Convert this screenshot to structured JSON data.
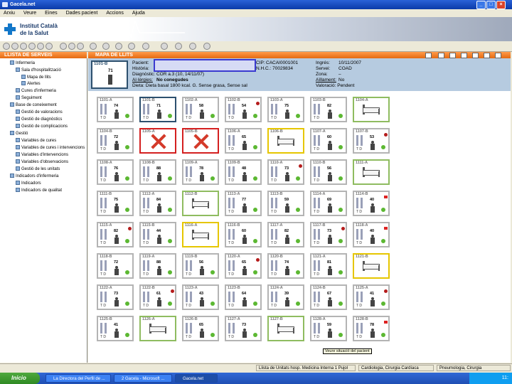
{
  "window": {
    "title": "Gacela.net",
    "min": "_",
    "max": "□",
    "close": "×"
  },
  "menu": [
    "Arxiu",
    "Veure",
    "Eines",
    "Dades pacient",
    "Accions",
    "Ajuda"
  ],
  "logo": {
    "line1": "Institut Català",
    "line2": "de la Salut"
  },
  "left_panel": {
    "title": "LLISTA DE SERVEIS",
    "items": [
      {
        "label": "Infermeria"
      },
      {
        "label": "Sala d'hospitalització"
      },
      {
        "label": "Mapa de llits"
      },
      {
        "label": "Alertes"
      },
      {
        "label": "Cures d'infermeria"
      },
      {
        "label": "Seguiment"
      },
      {
        "label": "Base de coneixement"
      },
      {
        "label": "Gestió de valoracions"
      },
      {
        "label": "Gestió de diagnòstics"
      },
      {
        "label": "Gestió de complicacions"
      },
      {
        "label": "Gestió"
      },
      {
        "label": "Variables de cures"
      },
      {
        "label": "Variables de cures i intervencions"
      },
      {
        "label": "Variables d'intervencions"
      },
      {
        "label": "Variables d'observacions"
      },
      {
        "label": "Gestió de les unitats"
      },
      {
        "label": "Indicadors d'infermeria"
      },
      {
        "label": "Indicadors"
      },
      {
        "label": "Indicadors de qualitat"
      }
    ]
  },
  "main": {
    "title": "MAPA DE LLITS",
    "selected_bed": {
      "number": "1101-B",
      "age": "71"
    },
    "info": {
      "pacient_label": "Pacient:",
      "historia_label": "Història:",
      "diagnostic": "Diagnòstic: COR a.3 (10, 14/11/07)",
      "alergies_label": "Al·lèrgies:",
      "alergies_value": "No conegudes",
      "dieta": "Dieta:   Dieta basal 1800 kcal. G. Sense grasa, Sense sal",
      "cip_label": "CIP:",
      "cip_value": "CACAI0001001",
      "nhc": "N.H.C.: 70029834",
      "ingres_label": "Ingrés:",
      "ingres_value": "10/11/2007",
      "servei_label": "Servei:",
      "servei_value": "COAD",
      "zona_label": "Zona:",
      "zona_value": "–",
      "aillament_label": "Aïllament:",
      "aillament_value": "No",
      "valoracio": "Valoració:   Pendent"
    },
    "tooltip": "Veure situació del pacient",
    "beds": [
      {
        "num": "1101-A",
        "age": "74",
        "state": "occupied"
      },
      {
        "num": "1101-B",
        "age": "71",
        "state": "sel"
      },
      {
        "num": "1102-A",
        "age": "58",
        "state": "occupied"
      },
      {
        "num": "1102-B",
        "age": "54",
        "state": "occupied"
      },
      {
        "num": "1103-A",
        "age": "75",
        "state": "occupied"
      },
      {
        "num": "1103-B",
        "age": "82",
        "state": "occupied"
      },
      {
        "num": "1104-A",
        "age": "",
        "state": "free"
      },
      {
        "num": "1104-B",
        "age": "72",
        "state": "occupied"
      },
      {
        "num": "1105-A",
        "age": "",
        "state": "blocked"
      },
      {
        "num": "1105-B",
        "age": "",
        "state": "blocked"
      },
      {
        "num": "1106-A",
        "age": "65",
        "state": "occupied"
      },
      {
        "num": "1106-B",
        "age": "",
        "state": "yellow"
      },
      {
        "num": "1107-A",
        "age": "60",
        "state": "occupied"
      },
      {
        "num": "1107-B",
        "age": "53",
        "state": "occupied"
      },
      {
        "num": "1108-A",
        "age": "76",
        "state": "occupied"
      },
      {
        "num": "1108-B",
        "age": "88",
        "state": "occupied"
      },
      {
        "num": "1109-A",
        "age": "78",
        "state": "occupied"
      },
      {
        "num": "1109-B",
        "age": "48",
        "state": "occupied"
      },
      {
        "num": "1110-A",
        "age": "73",
        "state": "occupied"
      },
      {
        "num": "1110-B",
        "age": "56",
        "state": "occupied"
      },
      {
        "num": "1111-A",
        "age": "",
        "state": "free"
      },
      {
        "num": "1111-B",
        "age": "75",
        "state": "occupied"
      },
      {
        "num": "1112-A",
        "age": "84",
        "state": "occupied"
      },
      {
        "num": "1112-B",
        "age": "",
        "state": "free"
      },
      {
        "num": "1113-A",
        "age": "77",
        "state": "occupied"
      },
      {
        "num": "1113-B",
        "age": "59",
        "state": "occupied"
      },
      {
        "num": "1114-A",
        "age": "69",
        "state": "occupied"
      },
      {
        "num": "1114-B",
        "age": "40",
        "state": "occupied"
      },
      {
        "num": "1115-A",
        "age": "82",
        "state": "occupied"
      },
      {
        "num": "1115-B",
        "age": "44",
        "state": "occupied"
      },
      {
        "num": "1116-A",
        "age": "",
        "state": "yellow"
      },
      {
        "num": "1116-B",
        "age": "60",
        "state": "occupied"
      },
      {
        "num": "1117-A",
        "age": "82",
        "state": "occupied"
      },
      {
        "num": "1117-B",
        "age": "73",
        "state": "occupied"
      },
      {
        "num": "1118-A",
        "age": "40",
        "state": "occupied"
      },
      {
        "num": "1118-B",
        "age": "72",
        "state": "occupied"
      },
      {
        "num": "1119-A",
        "age": "88",
        "state": "occupied"
      },
      {
        "num": "1119-B",
        "age": "56",
        "state": "occupied"
      },
      {
        "num": "1120-A",
        "age": "65",
        "state": "occupied"
      },
      {
        "num": "1120-B",
        "age": "74",
        "state": "occupied"
      },
      {
        "num": "1121-A",
        "age": "81",
        "state": "occupied"
      },
      {
        "num": "1121-B",
        "age": "",
        "state": "yellow"
      },
      {
        "num": "1122-A",
        "age": "73",
        "state": "occupied"
      },
      {
        "num": "1122-B",
        "age": "61",
        "state": "occupied"
      },
      {
        "num": "1123-A",
        "age": "43",
        "state": "occupied"
      },
      {
        "num": "1123-B",
        "age": "64",
        "state": "occupied"
      },
      {
        "num": "1124-A",
        "age": "39",
        "state": "occupied"
      },
      {
        "num": "1124-B",
        "age": "67",
        "state": "occupied"
      },
      {
        "num": "1125-A",
        "age": "41",
        "state": "occupied"
      },
      {
        "num": "1125-B",
        "age": "41",
        "state": "occupied"
      },
      {
        "num": "1126-A",
        "age": "",
        "state": "free"
      },
      {
        "num": "1126-B",
        "age": "65",
        "state": "occupied"
      },
      {
        "num": "1127-A",
        "age": "73",
        "state": "occupied"
      },
      {
        "num": "1127-B",
        "age": "",
        "state": "free"
      },
      {
        "num": "1128-A",
        "age": "59",
        "state": "occupied"
      },
      {
        "num": "1128-B",
        "age": "78",
        "state": "occupied"
      }
    ],
    "bed_td": "T    D"
  },
  "status": [
    "Llista de Unitats hosp. Medicina Interna 1 Pujol",
    "Cardiologia, Cirurgia Cardíaca",
    "Pneumologia, Cirurgia"
  ],
  "taskbar": {
    "start": "Inicio",
    "tasks": [
      "La Directora del Perfil de ...",
      "2 Gacela - Microsoft ...",
      "Gacela.net"
    ],
    "clock": "11:"
  },
  "colors": {
    "accent": "#e46a10",
    "info_bg": "#b6cbe0",
    "free": "#8fbc60",
    "blocked": "#d42020"
  }
}
